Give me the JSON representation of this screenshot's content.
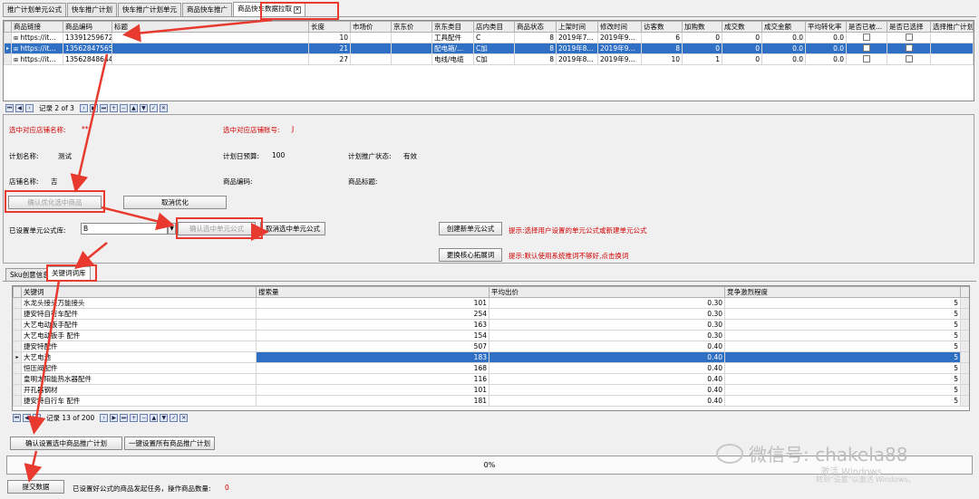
{
  "tabs": [
    {
      "label": "推广计划单元公式"
    },
    {
      "label": "快车推广计划"
    },
    {
      "label": "快车推广计划单元"
    },
    {
      "label": "商品快车推广"
    },
    {
      "label": "商品快车数据拉取"
    }
  ],
  "top_grid": {
    "columns": [
      "商品链接",
      "商品编码",
      "标题",
      "长度",
      "市场价",
      "京东价",
      "京东类目",
      "店内类目",
      "商品状态",
      "上架时间",
      "修改时间",
      "访客数",
      "加购数",
      "成交数",
      "成交金额",
      "平均转化率",
      "是否已被...",
      "是否已选择",
      "选择推广计划"
    ],
    "rows": [
      [
        "https://it...",
        "13391259672",
        "",
        "10",
        "",
        "",
        "工具配件",
        "C",
        "8",
        "2019年7...",
        "2019年9...",
        "6",
        "0",
        "0",
        "0.0",
        "0.0"
      ],
      [
        "https://it...",
        "13562847565",
        "",
        "21",
        "",
        "",
        "配电箱/...",
        "C加",
        "8",
        "2019年8...",
        "2019年9...",
        "8",
        "0",
        "0",
        "0.0",
        "0.0"
      ],
      [
        "https://it...",
        "13562848644",
        "",
        "27",
        "",
        "",
        "电线/电缆",
        "C加",
        "8",
        "2019年8...",
        "2019年9...",
        "10",
        "1",
        "0",
        "0.0",
        "0.0"
      ]
    ],
    "nav_text": "记录 2 of 3"
  },
  "form": {
    "shop_name_label": "选中对应店铺名称:",
    "shop_name_value": "**",
    "shop_account_label": "选中对应店铺账号:",
    "shop_account_value": "J",
    "plan_name_label": "计划名称:",
    "plan_name_value": "测试",
    "daily_budget_label": "计划日预算:",
    "daily_budget_value": "100",
    "plan_status_label": "计划推广状态:",
    "plan_status_value": "有效",
    "store_name_label": "店铺名称:",
    "store_name_value": "吉",
    "product_code_label": "商品编码:",
    "product_title_label": "商品标题:",
    "confirm_optimize_btn": "确认优化选中商品",
    "cancel_optimize_btn": "取消优化",
    "formula_lib_label": "已设置单元公式库:",
    "formula_lib_value": "B",
    "confirm_unit_formula_btn": "确认选中单元公式",
    "cancel_unit_formula_btn": "取消选中单元公式",
    "create_formula_btn": "创建新单元公式",
    "create_formula_hint": "提示:选择用户设置的单元公式或新建单元公式",
    "replace_keyword_btn": "更换核心拓展词",
    "replace_keyword_hint": "提示:默认使用系统推词不够好,点击换词"
  },
  "sub_tabs": [
    {
      "label": "Sku创意信息"
    },
    {
      "label": "关键词词库"
    }
  ],
  "kw_grid": {
    "columns": [
      "关键词",
      "搜索量",
      "平均出价",
      "竞争激烈程度"
    ],
    "rows": [
      [
        "水龙头接头万能接头",
        "101",
        "0.30",
        "5"
      ],
      [
        "捷安特自行车配件",
        "254",
        "0.30",
        "5"
      ],
      [
        "大艺电动扳手配件",
        "163",
        "0.30",
        "5"
      ],
      [
        "大艺电动扳手 配件",
        "154",
        "0.30",
        "5"
      ],
      [
        "捷安特配件",
        "507",
        "0.40",
        "5"
      ],
      [
        "大艺电池",
        "183",
        "0.40",
        "5"
      ],
      [
        "恒压阀配件",
        "168",
        "0.40",
        "5"
      ],
      [
        "皇明太阳能热水器配件",
        "116",
        "0.40",
        "5"
      ],
      [
        "开孔器钢材",
        "101",
        "0.40",
        "5"
      ],
      [
        "捷安特自行车 配件",
        "181",
        "0.40",
        "5"
      ]
    ],
    "nav_text": "记录 13 of 200"
  },
  "bottom": {
    "confirm_plan_btn": "确认设置选中商品推广计划",
    "set_all_btn": "一键设置所有商品推广计划",
    "progress_value": 0,
    "progress_text": "0%",
    "submit_btn": "提交数据",
    "submit_info_label": "已设置好公式的商品发起任务，操作商品数量:",
    "submit_info_value": "0"
  },
  "watermark": {
    "wechat": "微信号: chakela88",
    "win1": "激活 Windows",
    "win2": "转到\"设置\"以激活 Windows。"
  },
  "colors": {
    "selected_row": "#2f6fc4",
    "annotation_red": "#e83a2e",
    "label_red": "#d00000"
  }
}
